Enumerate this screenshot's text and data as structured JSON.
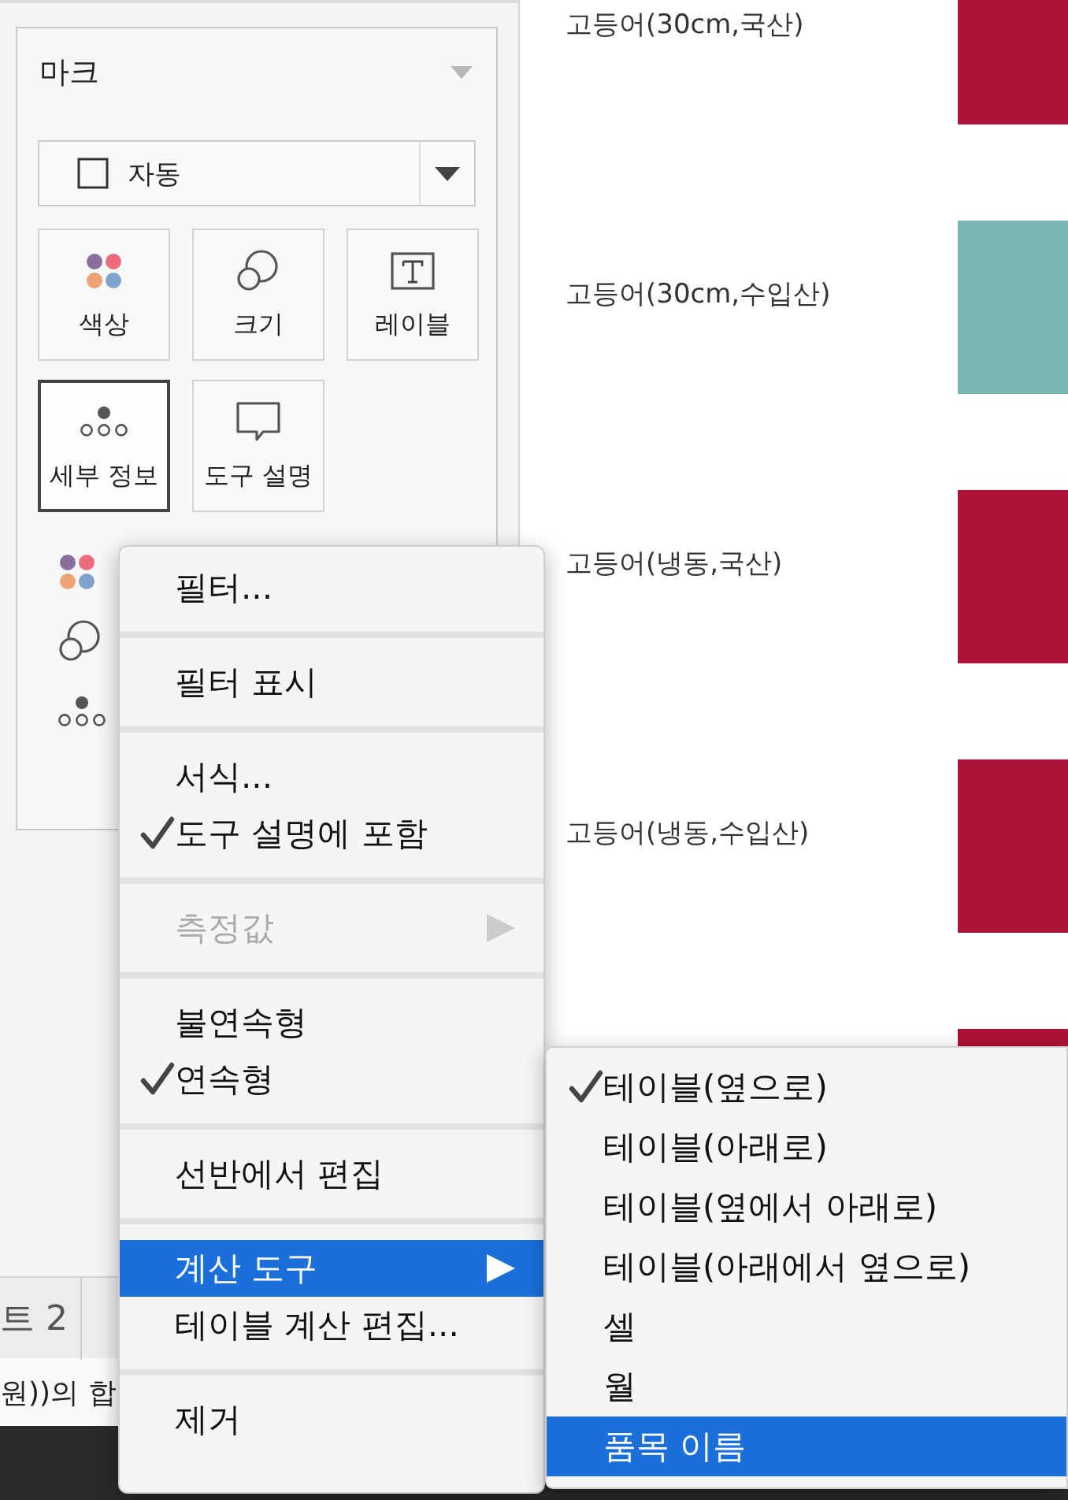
{
  "marks_card": {
    "title": "마크",
    "mark_type": "자동",
    "buttons": [
      {
        "label": "색상",
        "kind": "color",
        "selected": false
      },
      {
        "label": "크기",
        "kind": "size",
        "selected": false
      },
      {
        "label": "레이블",
        "kind": "label",
        "selected": false
      },
      {
        "label": "세부 정보",
        "kind": "detail",
        "selected": true
      },
      {
        "label": "도구 설명",
        "kind": "tooltip",
        "selected": false
      }
    ],
    "shelf": [
      {
        "kind": "color"
      },
      {
        "kind": "size"
      },
      {
        "kind": "detail"
      }
    ]
  },
  "chart_rows": [
    {
      "label": "고등어(30cm,국산)",
      "color": "#ad1238"
    },
    {
      "label": "고등어(30cm,수입산)",
      "color": "#79b6b0"
    },
    {
      "label": "고등어(냉동,국산)",
      "color": "#ad1238"
    },
    {
      "label": "고등어(냉동,수입산)",
      "color": "#ad1238"
    },
    {
      "color": "#ad1238"
    }
  ],
  "sheet_tabs": [
    {
      "label": "트 2"
    }
  ],
  "status_bar": "원))의 합",
  "context_menu": [
    {
      "kind": "item",
      "label": "필터...",
      "checked": false,
      "disabled": false,
      "submenu": false,
      "selected": false
    },
    {
      "kind": "separator"
    },
    {
      "kind": "item",
      "label": "필터 표시",
      "checked": false,
      "disabled": false,
      "submenu": false,
      "selected": false
    },
    {
      "kind": "separator"
    },
    {
      "kind": "item",
      "label": "서식...",
      "checked": false,
      "disabled": false,
      "submenu": false,
      "selected": false
    },
    {
      "kind": "item",
      "label": "도구 설명에 포함",
      "checked": true,
      "disabled": false,
      "submenu": false,
      "selected": false
    },
    {
      "kind": "separator"
    },
    {
      "kind": "item",
      "label": "측정값",
      "checked": false,
      "disabled": true,
      "submenu": true,
      "selected": false
    },
    {
      "kind": "separator"
    },
    {
      "kind": "item",
      "label": "불연속형",
      "checked": false,
      "disabled": false,
      "submenu": false,
      "selected": false
    },
    {
      "kind": "item",
      "label": "연속형",
      "checked": true,
      "disabled": false,
      "submenu": false,
      "selected": false
    },
    {
      "kind": "separator"
    },
    {
      "kind": "item",
      "label": "선반에서 편집",
      "checked": false,
      "disabled": false,
      "submenu": false,
      "selected": false
    },
    {
      "kind": "separator"
    },
    {
      "kind": "item",
      "label": "계산 도구",
      "checked": false,
      "disabled": false,
      "submenu": true,
      "selected": true
    },
    {
      "kind": "item",
      "label": "테이블 계산 편집...",
      "checked": false,
      "disabled": false,
      "submenu": false,
      "selected": false
    },
    {
      "kind": "separator"
    },
    {
      "kind": "item",
      "label": "제거",
      "checked": false,
      "disabled": false,
      "submenu": false,
      "selected": false
    }
  ],
  "submenu": [
    {
      "label": "테이블(옆으로)",
      "checked": true,
      "selected": false
    },
    {
      "label": "테이블(아래로)",
      "checked": false,
      "selected": false
    },
    {
      "label": "테이블(옆에서 아래로)",
      "checked": false,
      "selected": false
    },
    {
      "label": "테이블(아래에서 옆으로)",
      "checked": false,
      "selected": false
    },
    {
      "label": "셀",
      "checked": false,
      "selected": false
    },
    {
      "label": "월",
      "checked": false,
      "selected": false
    },
    {
      "label": "품목 이름",
      "checked": false,
      "selected": true
    }
  ]
}
